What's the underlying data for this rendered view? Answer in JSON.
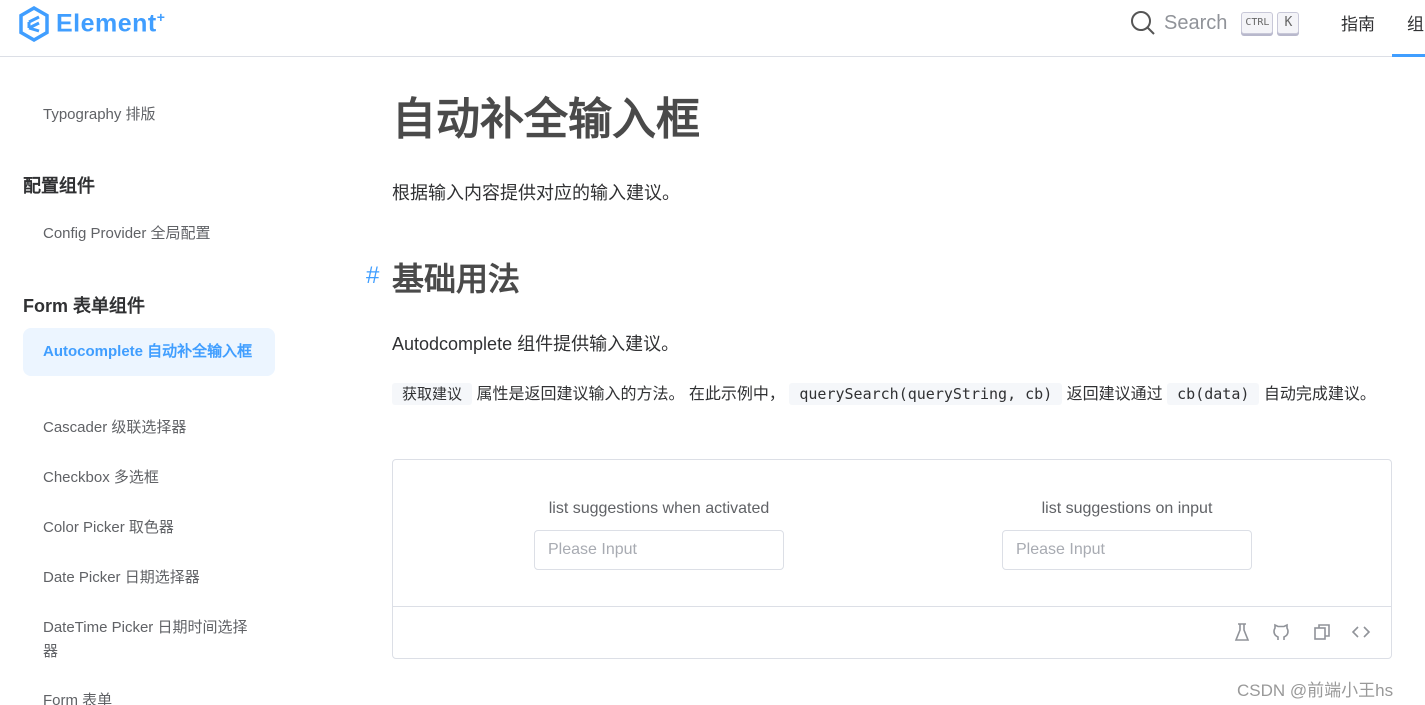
{
  "header": {
    "logo_text": "Element",
    "logo_sup": "+",
    "search_label": "Search",
    "kbd_ctrl": "CTRL",
    "kbd_k": "K",
    "nav": [
      "指南",
      "组"
    ]
  },
  "sidebar": {
    "partial_item": "Typography 排版",
    "groups": [
      {
        "title": "配置组件",
        "items": [
          "Config Provider 全局配置"
        ]
      },
      {
        "title": "Form 表单组件",
        "items": [
          "Autocomplete 自动补全输入框",
          "Cascader 级联选择器",
          "Checkbox 多选框",
          "Color Picker 取色器",
          "Date Picker 日期选择器",
          "DateTime Picker 日期时间选择器",
          "Form 表单"
        ]
      }
    ],
    "active_item": "Autocomplete 自动补全输入框"
  },
  "main": {
    "title": "自动补全输入框",
    "intro": "根据输入内容提供对应的输入建议。",
    "section_hash": "#",
    "section_title": "基础用法",
    "section_desc": "Autodcomplete 组件提供输入建议。",
    "desc_code1": "获取建议",
    "desc_t1": " 属性是返回建议输入的方法。 在此示例中， ",
    "desc_code2": "querySearch(queryString, cb)",
    "desc_t2": " 返回建议通过 ",
    "desc_code3": "cb(data)",
    "desc_t3": " 自动完成建议。",
    "demo": {
      "col1_label": "list suggestions when activated",
      "col2_label": "list suggestions on input",
      "placeholder": "Please Input"
    },
    "tools": [
      "flask-icon",
      "github-icon",
      "copy-icon",
      "code-icon"
    ]
  },
  "watermark": "CSDN @前端小王hs",
  "colors": {
    "accent": "#409eff"
  }
}
